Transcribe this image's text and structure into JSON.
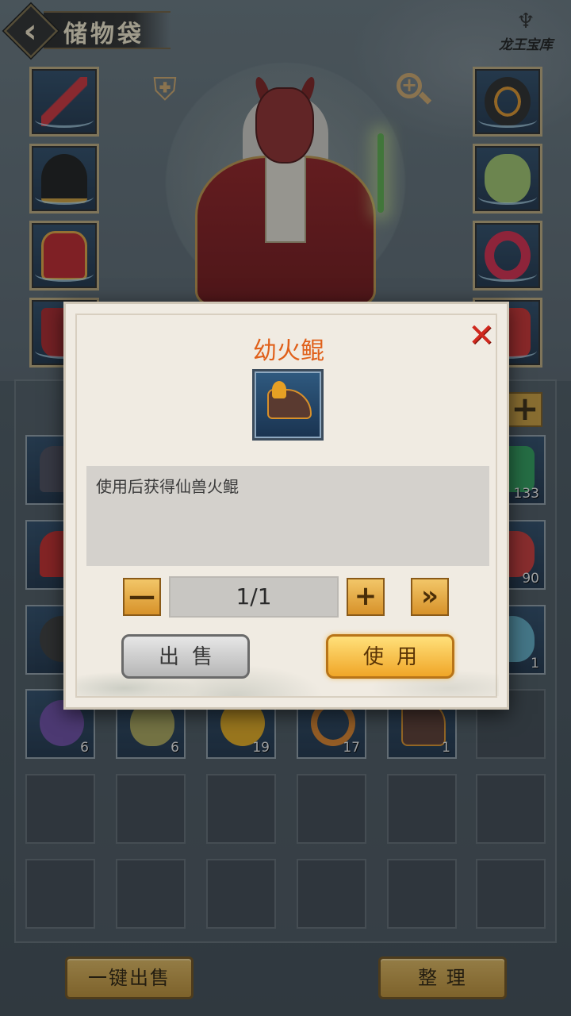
{
  "header": {
    "title": "储物袋",
    "logo_text": "龙王宝库"
  },
  "equipment": {
    "left_slots": [
      "weapon",
      "helmet",
      "armor",
      "boots"
    ],
    "right_slots": [
      "ring",
      "jade",
      "bracelet",
      "belt"
    ]
  },
  "inventory": {
    "row1_right_qty": "133",
    "row2_right_qty": "90",
    "row3_right_qty": "1",
    "row4": [
      {
        "name": "purple-fruit",
        "qty": "6"
      },
      {
        "name": "gourd",
        "qty": "6"
      },
      {
        "name": "golden-egg",
        "qty": "19"
      },
      {
        "name": "fire-ring",
        "qty": "17"
      },
      {
        "name": "fire-kun",
        "qty": "1"
      }
    ]
  },
  "bottom": {
    "sell_all_label": "一键出售",
    "sort_label": "整 理"
  },
  "modal": {
    "title": "幼火鲲",
    "description": "使用后获得仙兽火鲲",
    "quantity": "1/1",
    "minus_label": "—",
    "plus_label": "+",
    "max_label": "»",
    "sell_label": "出售",
    "use_label": "使用",
    "close_label": "✕"
  }
}
